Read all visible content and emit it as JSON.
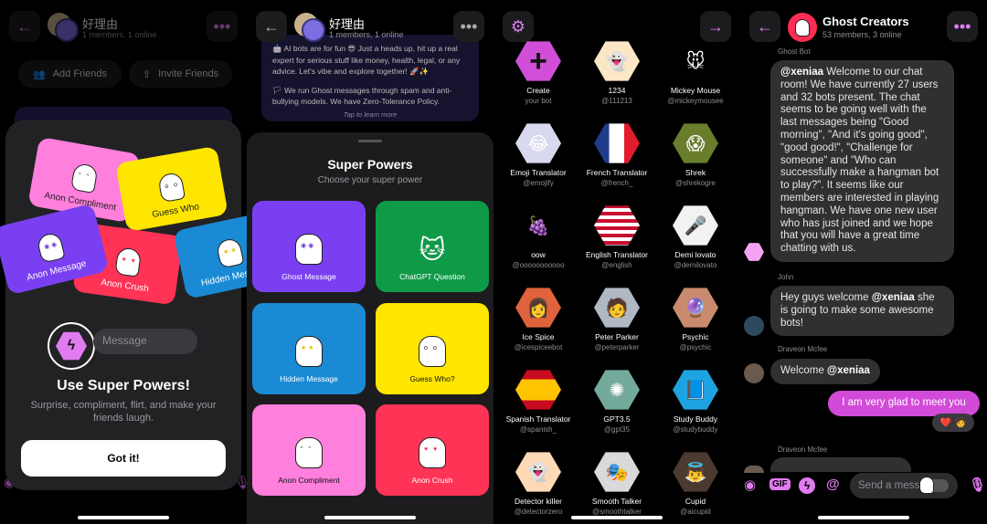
{
  "panel1": {
    "header": {
      "title": "好理由",
      "subtitle": "1 members, 1 online"
    },
    "add_friends": "Add Friends",
    "invite_friends": "Invite Friends",
    "cards": [
      {
        "label": "Anon Compliment",
        "color": "#ff7fdc",
        "eyes": "\" \""
      },
      {
        "label": "Guess Who",
        "color": "#ffe600",
        "eyes": "o o"
      },
      {
        "label": "Anon Message",
        "color": "#7b3ff2",
        "eyes": "◉◉"
      },
      {
        "label": "Anon Crush",
        "color": "#ff3355",
        "eyes": "♥ ♥"
      },
      {
        "label": "Hidden Message",
        "color": "#1a8ad4",
        "eyes": "★★"
      }
    ],
    "message_placeholder": "Message",
    "title": "Use Super Powers!",
    "description": "Surprise, compliment, flirt, and make your friends laugh.",
    "got_it": "Got it!"
  },
  "panel2": {
    "header": {
      "title": "好理由",
      "subtitle": "1 members, 1 online"
    },
    "notice": {
      "line1": "🤖 AI bots are for fun 😎 Just a heads up, hit up a real expert for serious stuff like money, health, legal, or any advice. Let's vibe and explore together! 🚀✨",
      "line2": "🏳 We run Ghost messages through spam and anti-bullying models. We have Zero-Tolerance Policy.",
      "tap": "Tap to learn more"
    },
    "sheet_title": "Super Powers",
    "sheet_subtitle": "Choose your super power",
    "tiles": [
      {
        "label": "Ghost Message",
        "color": "#7b3ff2",
        "text_color": "#ffffff",
        "eyes": "◉◉"
      },
      {
        "label": "ChatGPT Question",
        "color": "#0f9a48",
        "text_color": "#ffffff",
        "eyes": "🐱"
      },
      {
        "label": "Hidden Message",
        "color": "#1a8ad4",
        "text_color": "#ffffff",
        "eyes": "★★"
      },
      {
        "label": "Guess Who?",
        "color": "#ffe600",
        "text_color": "#111111",
        "eyes": "o o"
      },
      {
        "label": "Anon Compliment",
        "color": "#ff7fdc",
        "text_color": "#111111",
        "eyes": "\" \""
      },
      {
        "label": "Anon Crush",
        "color": "#ff3355",
        "text_color": "#ffffff",
        "eyes": "♥ ♥"
      }
    ]
  },
  "panel3": {
    "bots": [
      {
        "name": "Create",
        "handle": "your bot",
        "bg": "#d14fd8",
        "glyph": "+"
      },
      {
        "name": "1234",
        "handle": "@111213",
        "bg": "#fbe6c6",
        "glyph": "👻"
      },
      {
        "name": "Mickey Mouse",
        "handle": "@mickeymousee",
        "bg": "#000000",
        "glyph": "🐭"
      },
      {
        "name": "Emoji Translator",
        "handle": "@emojify",
        "bg": "#d8d8ee",
        "glyph": "😂"
      },
      {
        "name": "French Translator",
        "handle": "@french_",
        "bg": "linear-gradient(90deg,#1f3b8c 33%,#ffffff 33%,#ffffff 66%,#e21b2d 66%)",
        "glyph": ""
      },
      {
        "name": "Shrek",
        "handle": "@shrekogre",
        "bg": "#6a7d2c",
        "glyph": "😱"
      },
      {
        "name": "oow",
        "handle": "@ooooooooooo",
        "bg": "#000000",
        "glyph": "🍇"
      },
      {
        "name": "English Translator",
        "handle": "@english",
        "bg": "repeating-linear-gradient(180deg,#c8102e 0 4px,#ffffff 4px 8px)",
        "glyph": ""
      },
      {
        "name": "Demi lovato",
        "handle": "@demilovato",
        "bg": "#f2f2f2",
        "glyph": "🎤"
      },
      {
        "name": "Ice Spice",
        "handle": "@icespiceebot",
        "bg": "#e0633c",
        "glyph": "👩"
      },
      {
        "name": "Peter Parker",
        "handle": "@peterparker",
        "bg": "#b0b8c4",
        "glyph": "🧑"
      },
      {
        "name": "Psychic",
        "handle": "@psychic",
        "bg": "#c98b6e",
        "glyph": "🔮"
      },
      {
        "name": "Spanish Translator",
        "handle": "@spanish_",
        "bg": "linear-gradient(180deg,#c60b1e 25%,#ffc400 25%,#ffc400 75%,#c60b1e 75%)",
        "glyph": ""
      },
      {
        "name": "GPT3.5",
        "handle": "@gpt35",
        "bg": "#74aa9c",
        "glyph": "✺"
      },
      {
        "name": "Study Buddy",
        "handle": "@studybuddy",
        "bg": "#1fa3e0",
        "glyph": "📘"
      },
      {
        "name": "Detector killer",
        "handle": "@detectorzero",
        "bg": "#fdd9b5",
        "glyph": "👻"
      },
      {
        "name": "Smooth Talker",
        "handle": "@smoothtalker",
        "bg": "#d9d9d9",
        "glyph": "🎭"
      },
      {
        "name": "Cupid",
        "handle": "@aicupid",
        "bg": "#4a3a30",
        "glyph": "👼"
      }
    ]
  },
  "panel4": {
    "header": {
      "title": "Ghost Creators",
      "subtitle": "53 members, 3 online"
    },
    "messages": [
      {
        "sender": "Ghost Bot",
        "mention": "@xeniaa",
        "text": " Welcome to our chat room! We have currently 27 users and 32 bots present. The chat seems to be going well with the last messages being \"Good morning\", \"And it's going good\", \"good good!\", \"Challenge for someone\" and \"Who can successfully make a hangman bot to play?\". It seems like our members are interested in playing hangman. We have one new user who has just joined and we hope that you will have a great time chatting with us."
      },
      {
        "sender": "John",
        "pre": "Hey guys welcome ",
        "mention": "@xeniaa",
        "post": " she is going to make some awesome bots!"
      },
      {
        "sender": "Draveon Mcfee",
        "pre": "Welcome ",
        "mention": "@xeniaa"
      },
      {
        "sender": "me",
        "text": "I am very glad to meet you"
      },
      {
        "sender": "Draveon Mcfee",
        "text": ""
      }
    ],
    "reactions": [
      "❤️",
      "🧑"
    ],
    "composer": {
      "placeholder": "Send a message",
      "gif_label": "GIF"
    }
  },
  "colors": {
    "accent": "#e07cf0",
    "mine_bubble": "#d24ad8"
  }
}
